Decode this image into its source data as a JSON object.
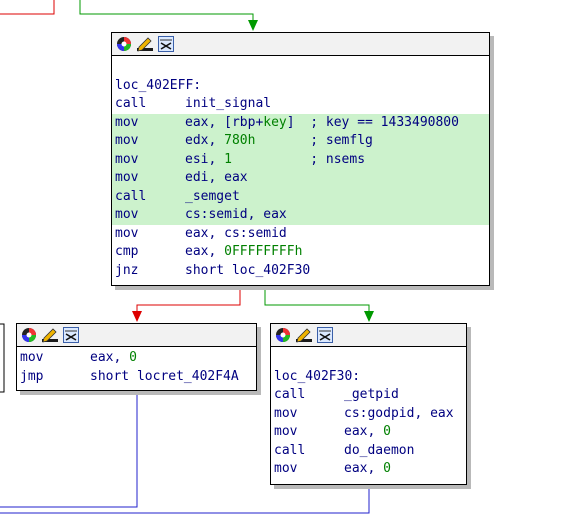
{
  "colors": {
    "edge_true": "#009900",
    "edge_false": "#dd0000",
    "edge_uncond": "#2222cc",
    "highlight": "#ccf2cc",
    "text": "#000080",
    "number": "#008000"
  },
  "header_icons": [
    "color-palette-icon",
    "edit-pencil-icon",
    "graph-grouping-icon"
  ],
  "block_main": {
    "label": "loc_402EFF:",
    "lines": [
      {
        "mnem": "call",
        "ops": "init_signal",
        "num": "",
        "ops2": "",
        "comment": ""
      },
      {
        "mnem": "mov",
        "ops": "eax, [rbp+",
        "num": "key",
        "ops2": "]",
        "comment": "  ; key == 1433490800"
      },
      {
        "mnem": "mov",
        "ops": "edx, ",
        "num": "780h",
        "ops2": "",
        "comment": "       ; semflg"
      },
      {
        "mnem": "mov",
        "ops": "esi, ",
        "num": "1",
        "ops2": "",
        "comment": "          ; nsems"
      },
      {
        "mnem": "mov",
        "ops": "edi, eax",
        "num": "",
        "ops2": "",
        "comment": ""
      },
      {
        "mnem": "call",
        "ops": "_semget",
        "num": "",
        "ops2": "",
        "comment": ""
      },
      {
        "mnem": "mov",
        "ops": "cs:semid, eax",
        "num": "",
        "ops2": "",
        "comment": ""
      },
      {
        "mnem": "mov",
        "ops": "eax, cs:semid",
        "num": "",
        "ops2": "",
        "comment": ""
      },
      {
        "mnem": "cmp",
        "ops": "eax, ",
        "num": "0FFFFFFFFh",
        "ops2": "",
        "comment": ""
      },
      {
        "mnem": "jnz",
        "ops": "short loc_402F30",
        "num": "",
        "ops2": "",
        "comment": ""
      }
    ]
  },
  "block_left": {
    "lines": [
      {
        "mnem": "mov",
        "ops": "eax, ",
        "num": "0",
        "ops2": "",
        "comment": ""
      },
      {
        "mnem": "jmp",
        "ops": "short locret_402F4A",
        "num": "",
        "ops2": "",
        "comment": ""
      }
    ]
  },
  "block_right": {
    "label": "loc_402F30:",
    "lines": [
      {
        "mnem": "call",
        "ops": "_getpid",
        "num": "",
        "ops2": "",
        "comment": ""
      },
      {
        "mnem": "mov",
        "ops": "cs:godpid, eax",
        "num": "",
        "ops2": "",
        "comment": ""
      },
      {
        "mnem": "mov",
        "ops": "eax, ",
        "num": "0",
        "ops2": "",
        "comment": ""
      },
      {
        "mnem": "call",
        "ops": "do_daemon",
        "num": "",
        "ops2": "",
        "comment": ""
      },
      {
        "mnem": "mov",
        "ops": "eax, ",
        "num": "0",
        "ops2": "",
        "comment": ""
      }
    ]
  }
}
